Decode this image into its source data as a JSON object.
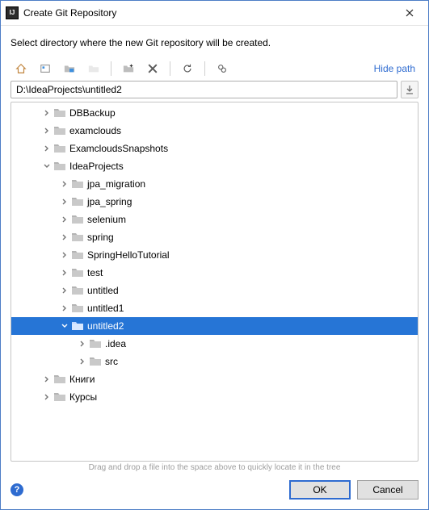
{
  "titlebar": {
    "title": "Create Git Repository"
  },
  "instruction": "Select directory where the new Git repository will be created.",
  "toolbar": {
    "hide_path": "Hide path"
  },
  "path": {
    "value": "D:\\IdeaProjects\\untitled2"
  },
  "tree": {
    "items": [
      {
        "depth": 1,
        "expand": "collapsed",
        "label": "DBBackup",
        "selected": false
      },
      {
        "depth": 1,
        "expand": "collapsed",
        "label": "examclouds",
        "selected": false
      },
      {
        "depth": 1,
        "expand": "collapsed",
        "label": "ExamcloudsSnapshots",
        "selected": false
      },
      {
        "depth": 1,
        "expand": "expanded",
        "label": "IdeaProjects",
        "selected": false
      },
      {
        "depth": 2,
        "expand": "collapsed",
        "label": "jpa_migration",
        "selected": false
      },
      {
        "depth": 2,
        "expand": "collapsed",
        "label": "jpa_spring",
        "selected": false
      },
      {
        "depth": 2,
        "expand": "collapsed",
        "label": "selenium",
        "selected": false
      },
      {
        "depth": 2,
        "expand": "collapsed",
        "label": "spring",
        "selected": false
      },
      {
        "depth": 2,
        "expand": "collapsed",
        "label": "SpringHelloTutorial",
        "selected": false
      },
      {
        "depth": 2,
        "expand": "collapsed",
        "label": "test",
        "selected": false
      },
      {
        "depth": 2,
        "expand": "collapsed",
        "label": "untitled",
        "selected": false
      },
      {
        "depth": 2,
        "expand": "collapsed",
        "label": "untitled1",
        "selected": false
      },
      {
        "depth": 2,
        "expand": "expanded",
        "label": "untitled2",
        "selected": true
      },
      {
        "depth": 3,
        "expand": "collapsed",
        "label": ".idea",
        "selected": false
      },
      {
        "depth": 3,
        "expand": "collapsed",
        "label": "src",
        "selected": false
      },
      {
        "depth": 1,
        "expand": "collapsed",
        "label": "Книги",
        "selected": false
      },
      {
        "depth": 1,
        "expand": "collapsed",
        "label": "Курсы",
        "selected": false
      }
    ]
  },
  "hint": "Drag and drop a file into the space above to quickly locate it in the tree",
  "buttons": {
    "ok": "OK",
    "cancel": "Cancel"
  }
}
